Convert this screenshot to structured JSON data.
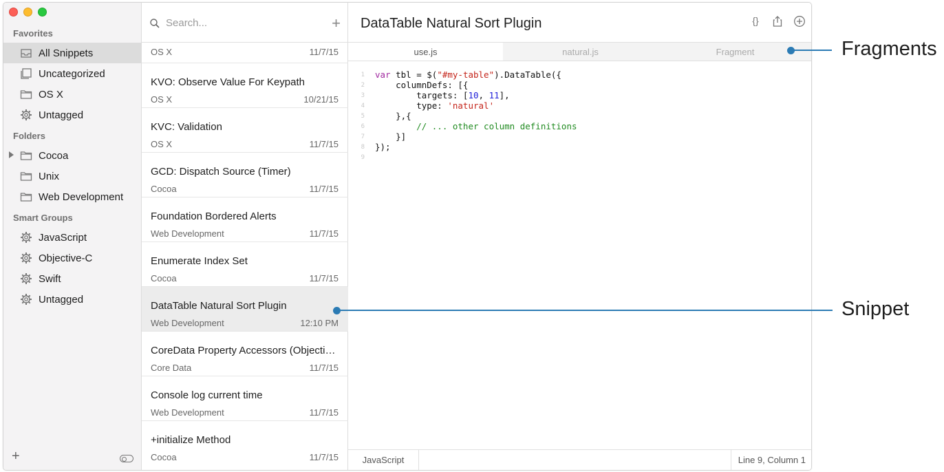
{
  "sidebar": {
    "sections": {
      "favorites": "Favorites",
      "folders": "Folders",
      "smart_groups": "Smart Groups"
    },
    "favorites": [
      {
        "label": "All Snippets",
        "icon": "inbox-icon"
      },
      {
        "label": "Uncategorized",
        "icon": "stack-icon"
      },
      {
        "label": "OS X",
        "icon": "folder-icon"
      },
      {
        "label": "Untagged",
        "icon": "gear-icon"
      }
    ],
    "folders": [
      {
        "label": "Cocoa",
        "icon": "folder-icon"
      },
      {
        "label": "Unix",
        "icon": "folder-icon"
      },
      {
        "label": "Web Development",
        "icon": "folder-icon"
      }
    ],
    "smart_groups": [
      {
        "label": "JavaScript",
        "icon": "gear-icon"
      },
      {
        "label": "Objective-C",
        "icon": "gear-icon"
      },
      {
        "label": "Swift",
        "icon": "gear-icon"
      },
      {
        "label": "Untagged",
        "icon": "gear-icon"
      }
    ],
    "footer": {
      "add": "+"
    }
  },
  "list": {
    "search_placeholder": "Search...",
    "add": "+",
    "partial_row": {
      "category": "OS X",
      "date": "11/7/15"
    },
    "rows": [
      {
        "title": "KVO: Observe Value For Keypath",
        "category": "OS X",
        "date": "10/21/15"
      },
      {
        "title": "KVC: Validation",
        "category": "OS X",
        "date": "11/7/15"
      },
      {
        "title": "GCD: Dispatch Source (Timer)",
        "category": "Cocoa",
        "date": "11/7/15"
      },
      {
        "title": "Foundation Bordered Alerts",
        "category": "Web Development",
        "date": "11/7/15"
      },
      {
        "title": "Enumerate Index Set",
        "category": "Cocoa",
        "date": "11/7/15"
      },
      {
        "title": "DataTable Natural Sort Plugin",
        "category": "Web Development",
        "date": "12:10 PM"
      },
      {
        "title": "CoreData Property Accessors (Objective-C)",
        "category": "Core Data",
        "date": "11/7/15"
      },
      {
        "title": "Console log current time",
        "category": "Web Development",
        "date": "11/7/15"
      },
      {
        "title": "+initialize Method",
        "category": "Cocoa",
        "date": "11/7/15"
      }
    ]
  },
  "editor": {
    "title": "DataTable Natural Sort Plugin",
    "actions": {
      "braces": "{}"
    },
    "tabs": [
      "use.js",
      "natural.js",
      "Fragment"
    ],
    "line_numbers": [
      "1",
      "2",
      "3",
      "4",
      "5",
      "6",
      "7",
      "8",
      "9"
    ],
    "code": {
      "l1_kw": "var",
      "l1_a": " tbl = $(",
      "l1_str": "\"#my-table\"",
      "l1_b": ").DataTable({",
      "l2": "    columnDefs: [{",
      "l3_a": "        targets: [",
      "l3_n1": "10",
      "l3_sep": ", ",
      "l3_n2": "11",
      "l3_b": "],",
      "l4_a": "        type: ",
      "l4_str": "'natural'",
      "l5": "    },{",
      "l6": "        // ... other column definitions",
      "l7": "    }]",
      "l8": "});",
      "l9": ""
    },
    "status": {
      "language": "JavaScript",
      "position": "Line 9, Column 1"
    }
  },
  "annotations": {
    "fragments": "Fragments",
    "snippet": "Snippet",
    "color": "#2b7bb4"
  }
}
